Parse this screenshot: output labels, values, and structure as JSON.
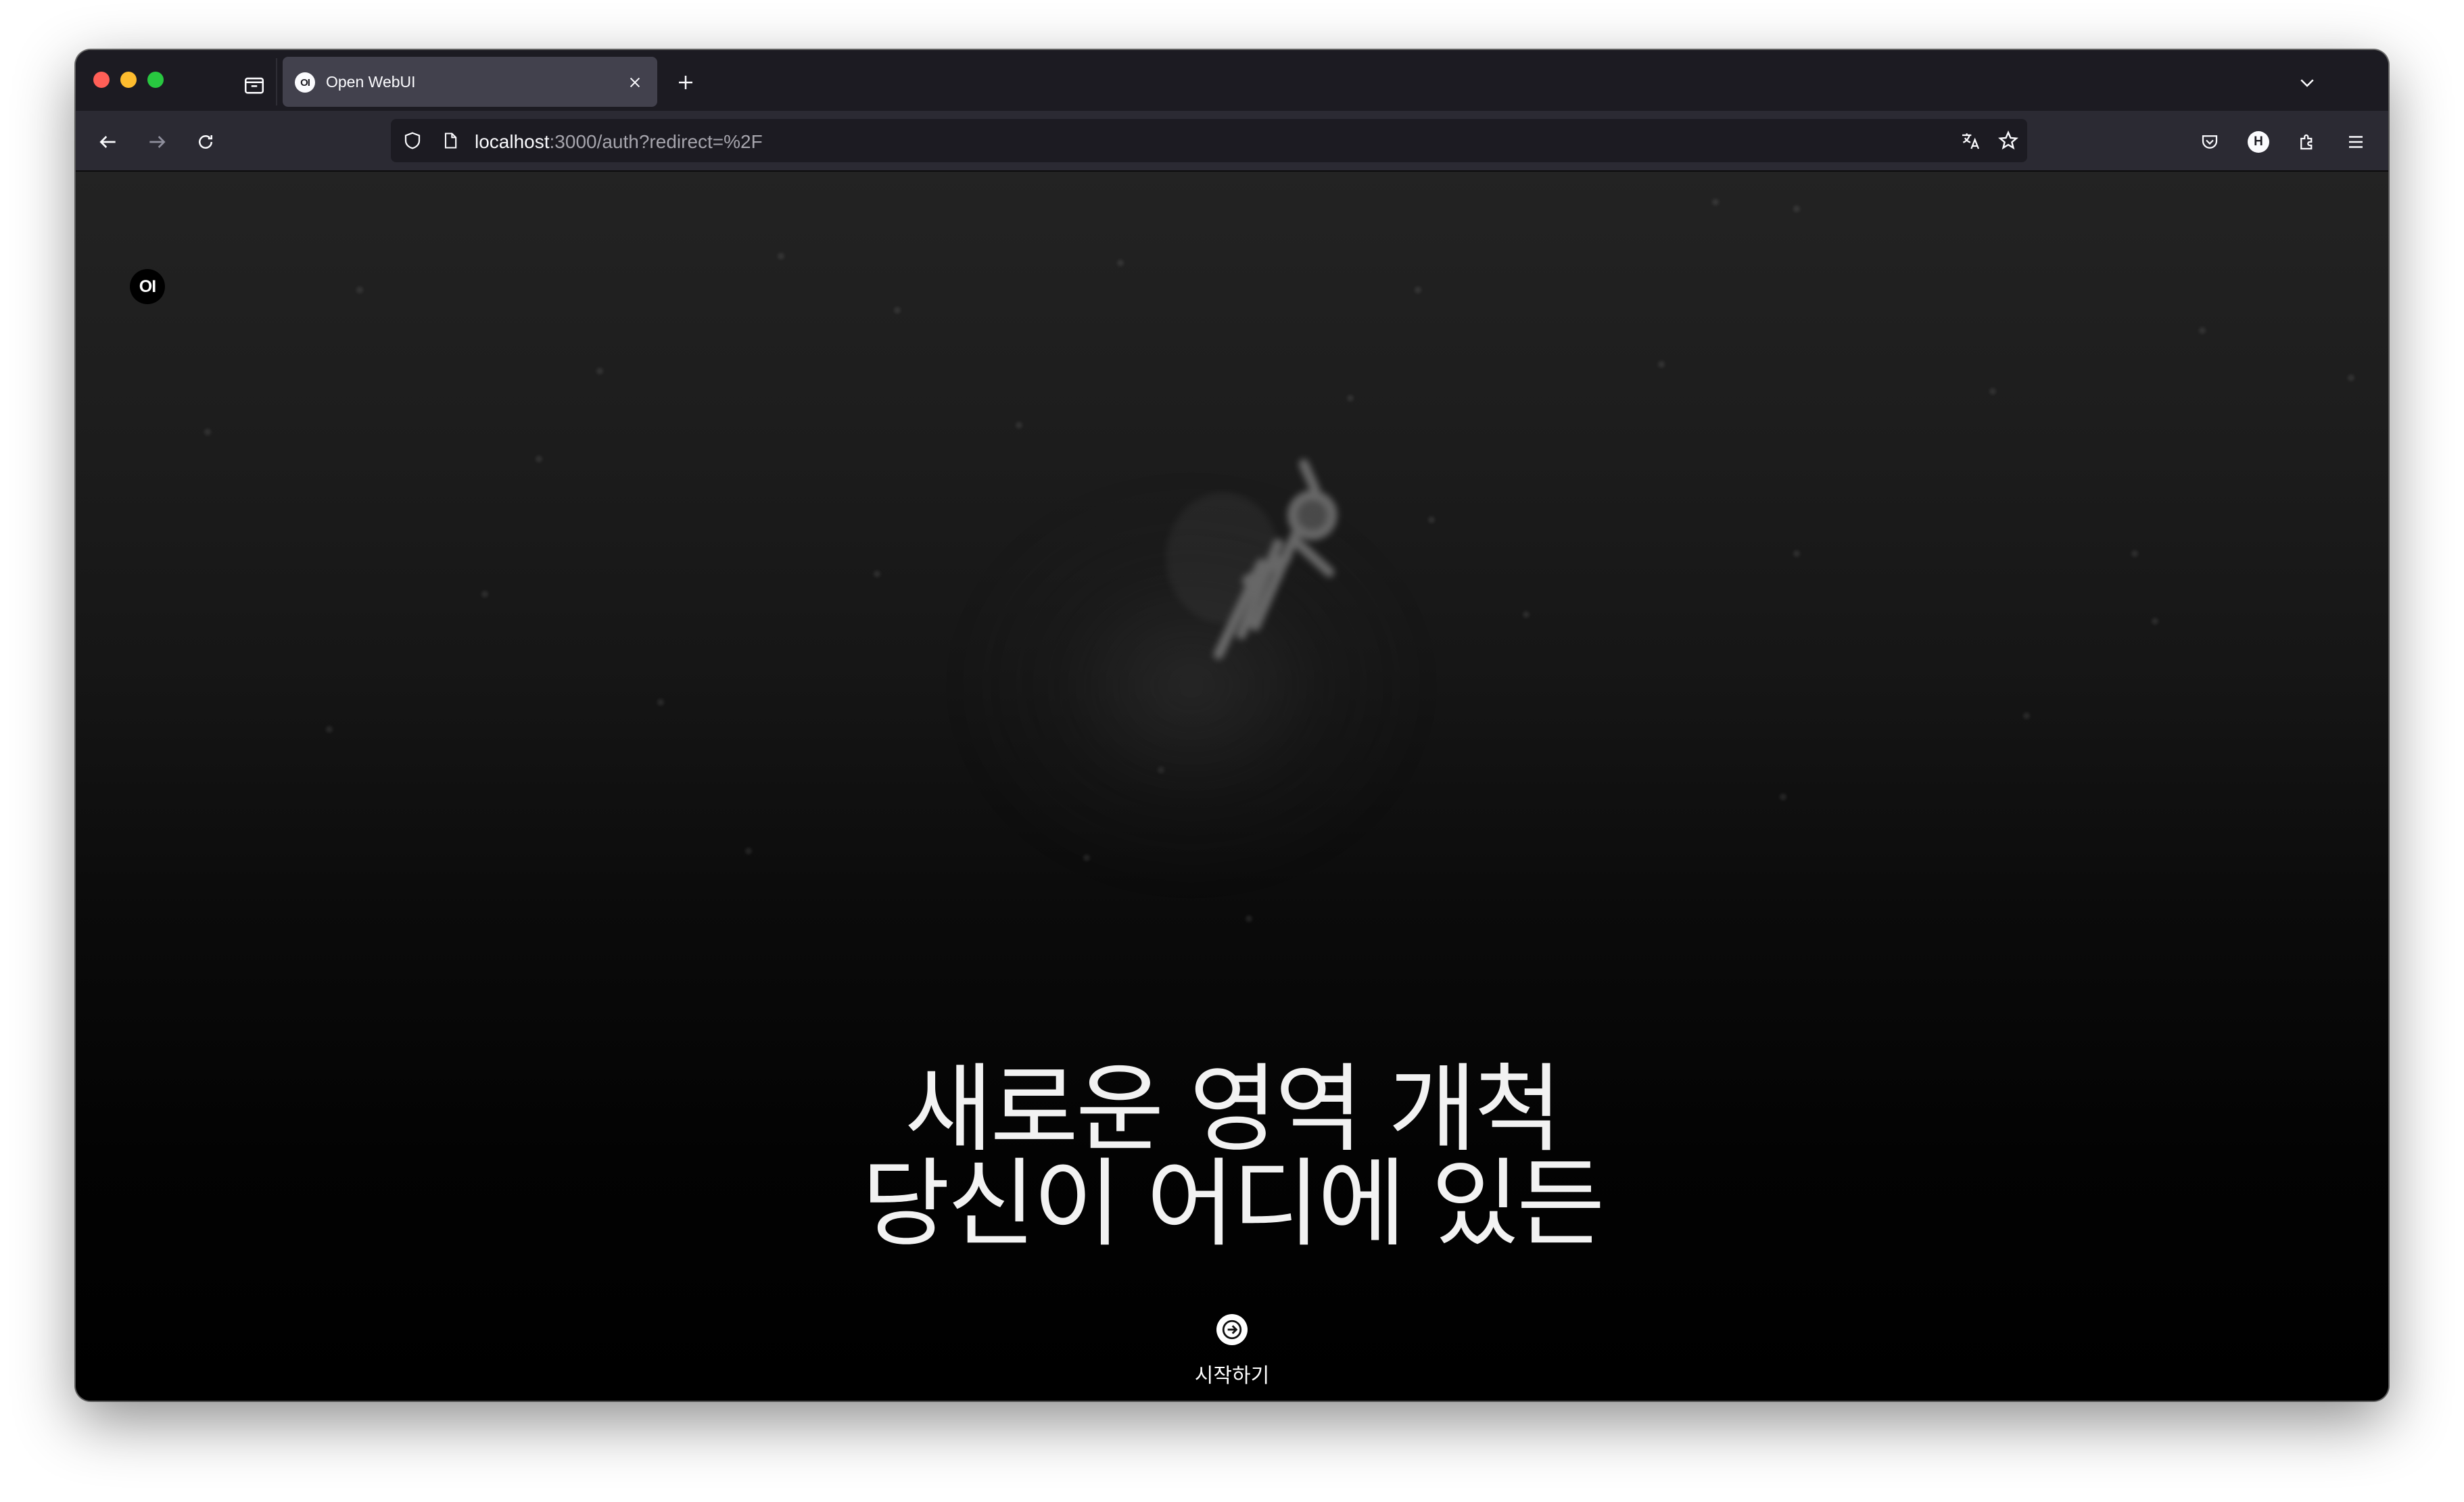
{
  "browser": {
    "tab": {
      "favicon_text": "OI",
      "title": "Open WebUI"
    },
    "url": {
      "host": "localhost",
      "rest": ":3000/auth?redirect=%2F"
    },
    "profile_initial": "H",
    "icons": {
      "tab_overview": "tab-overview-icon",
      "close": "close-icon",
      "new_tab": "plus-icon",
      "tab_list": "chevron-down-icon",
      "back": "arrow-left-icon",
      "forward": "arrow-right-icon",
      "reload": "reload-icon",
      "shield": "shield-icon",
      "page": "page-icon",
      "translate": "translate-icon",
      "bookmark": "star-icon",
      "pocket": "pocket-icon",
      "extensions": "puzzle-icon",
      "menu": "hamburger-icon"
    }
  },
  "app": {
    "logo_text": "OI",
    "headline_line1": "새로운 영역 개척",
    "headline_line2": "당신이 어디에 있든",
    "start_label": "시작하기"
  },
  "colors": {
    "tabstrip_bg": "#1c1b22",
    "navbar_bg": "#2b2a33",
    "active_tab_bg": "#42414d",
    "page_top": "#232323",
    "page_bottom": "#000000",
    "headline": "#f2f2f2"
  }
}
